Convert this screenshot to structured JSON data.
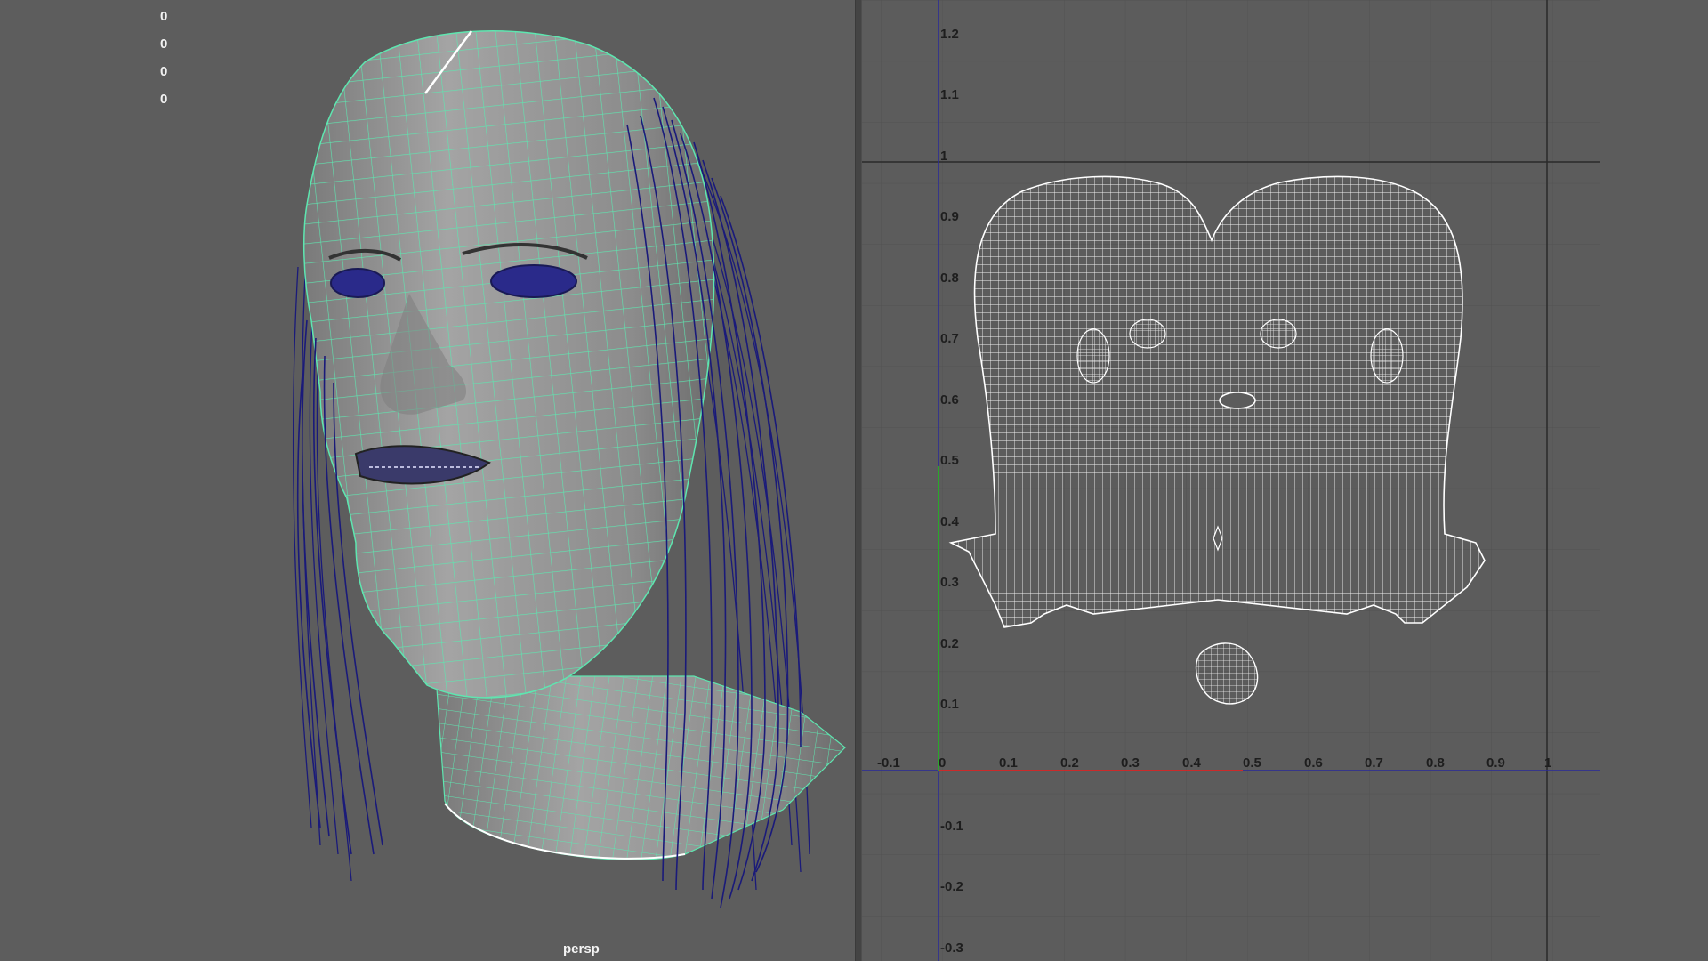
{
  "viewport": {
    "hud_values": [
      "0",
      "0",
      "0",
      "0"
    ],
    "camera_label": "persp"
  },
  "uv_editor": {
    "u_ticks": [
      "-0.1",
      "0",
      "0.1",
      "0.2",
      "0.3",
      "0.4",
      "0.5",
      "0.6",
      "0.7",
      "0.8",
      "0.9",
      "1"
    ],
    "v_ticks": [
      "1.2",
      "1.1",
      "1",
      "0.9",
      "0.8",
      "0.7",
      "0.6",
      "0.5",
      "0.4",
      "0.3",
      "0.2",
      "0.1",
      "-0.1",
      "-0.2",
      "-0.3"
    ]
  },
  "colors": {
    "viewport_bg": "#5d5d5d",
    "mesh_fill": "#9a9a9a",
    "wireframe": "#5ee6b0",
    "hair": "#1a1a7a",
    "uv_lines": "#ffffff",
    "u_axis": "#cc2a2a",
    "v_axis": "#2aa82a"
  },
  "icons": [
    "head-mesh-icon",
    "hair-curves-icon",
    "uv-shell-face-icon",
    "uv-shell-mouth-icon"
  ]
}
